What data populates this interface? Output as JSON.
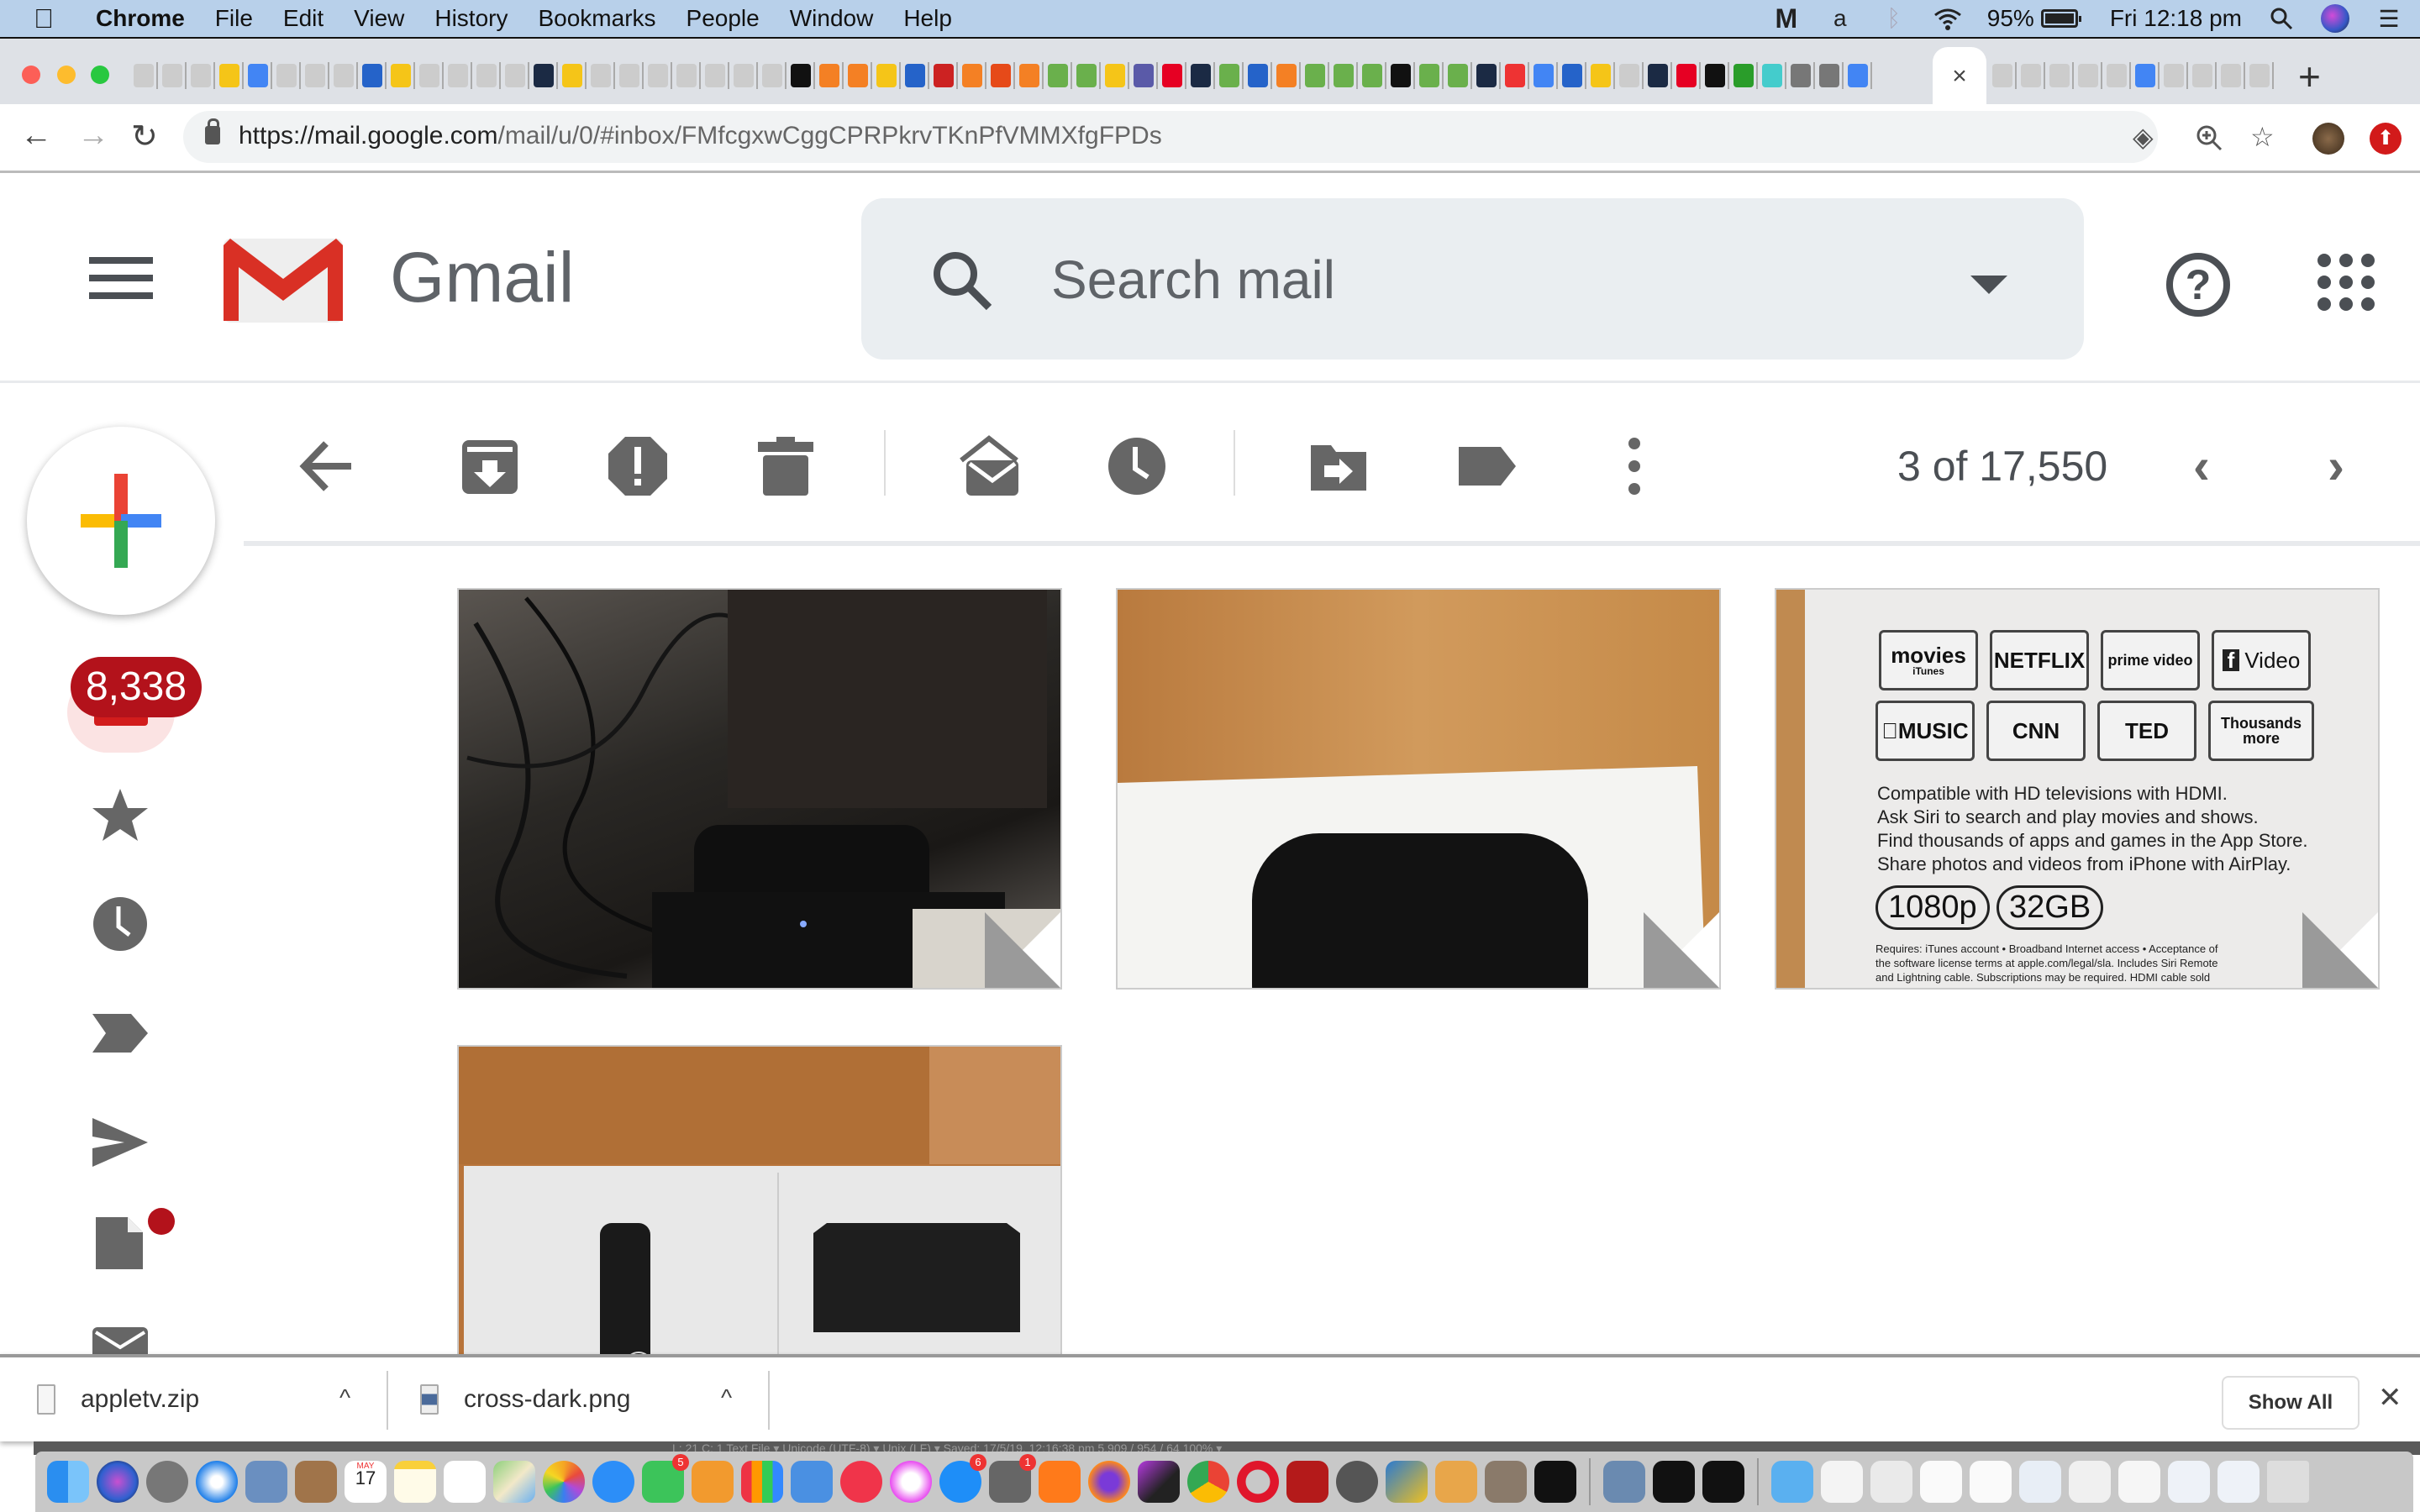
{
  "menubar": {
    "app_name": "Chrome",
    "items": [
      "File",
      "Edit",
      "View",
      "History",
      "Bookmarks",
      "People",
      "Window",
      "Help"
    ],
    "status": {
      "battery_percent": "95%",
      "clock": "Fri 12:18 pm",
      "icons": [
        "malwarebytes-icon",
        "avast-icon",
        "bluetooth-icon",
        "wifi-icon",
        "battery-icon",
        "spotlight-icon",
        "siri-icon",
        "notification-center-icon"
      ]
    }
  },
  "browser": {
    "active_tab_close": "×",
    "new_tab": "+",
    "url_host": "https://mail.google.com",
    "url_path": "/mail/u/0/#inbox/FMfcgxwCggCPRPkrvTKnPfVMMXfgFPDs",
    "nav": {
      "back": "←",
      "forward": "→",
      "reload": "↻"
    },
    "update_icon": "⬆"
  },
  "gmail": {
    "title": "Gmail",
    "search_placeholder": "Search mail",
    "help": "?",
    "inbox_count": "8,338",
    "nav_items": [
      "inbox",
      "starred",
      "snoozed",
      "important",
      "sent",
      "drafts",
      "all-mail"
    ],
    "toolbar": {
      "actions": [
        "back",
        "archive",
        "report-spam",
        "delete",
        "mark-unread",
        "snooze",
        "move-to",
        "labels",
        "more"
      ],
      "pager": "3 of 17,550"
    },
    "attachments": [
      {
        "name": "photo-cables-appletv",
        "desc": "Apple TV on desk with cables"
      },
      {
        "name": "photo-appletv-box",
        "desc": "Apple TV box on wooden surface"
      },
      {
        "name": "photo-box-back",
        "desc": "Back of Apple TV box",
        "logos": [
          "movies",
          "NETFLIX",
          "prime video",
          "Video",
          "MUSIC",
          "CNN",
          "TED",
          "Thousands more"
        ],
        "logos_sub": {
          "movies": "iTunes"
        },
        "lines": [
          "Compatible with HD televisions with HDMI.",
          "Ask Siri to search and play movies and shows.",
          "Find thousands of apps and games in the App Store.",
          "Share photos and videos from iPhone with AirPlay."
        ],
        "pills": [
          "1080p",
          "32GB"
        ],
        "fine_print": [
          "Requires: iTunes account • Broadband Internet access • Acceptance of",
          "the software license terms at apple.com/legal/sla. Includes Siri Remote",
          "and Lightning cable. Subscriptions may be required. HDMI cable sold"
        ]
      },
      {
        "name": "photo-manual",
        "desc": "Apple TV quick start manual"
      }
    ]
  },
  "downloads": {
    "items": [
      {
        "name": "appletv.zip",
        "caret": "^"
      },
      {
        "name": "cross-dark.png",
        "caret": "^"
      }
    ],
    "show_all": "Show All",
    "close": "✕"
  },
  "background_status": "L: 21 C: 1    Text File ▾   Unicode (UTF-8) ▾   Unix (LF) ▾      Saved: 17/5/19, 12:16:38 pm     5,909 / 954 / 64    100% ▾",
  "dock": {
    "calendar_month": "MAY",
    "calendar_day": "17",
    "badges": {
      "facetime": "5",
      "appstore": "6",
      "sysprefs": "1"
    }
  }
}
